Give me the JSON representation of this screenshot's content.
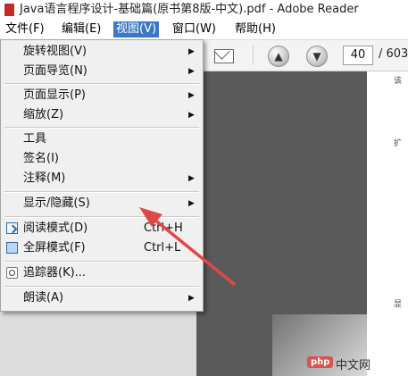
{
  "window": {
    "title": "Java语言程序设计-基础篇(原书第8版-中文).pdf - Adobe Reader"
  },
  "menubar": {
    "items": [
      {
        "label": "文件(F)"
      },
      {
        "label": "编辑(E)"
      },
      {
        "label": "视图(V)",
        "active": true
      },
      {
        "label": "窗口(W)"
      },
      {
        "label": "帮助(H)"
      }
    ]
  },
  "toolbar": {
    "page_number": "40",
    "page_count": "/ 603"
  },
  "view_menu": {
    "items": [
      {
        "label": "旋转视图(V)",
        "submenu": true
      },
      {
        "label": "页面导览(N)",
        "submenu": true
      },
      {
        "label": "页面显示(P)",
        "submenu": true
      },
      {
        "label": "缩放(Z)",
        "submenu": true
      },
      {
        "label": "工具"
      },
      {
        "label": "签名(I)"
      },
      {
        "label": "注释(M)",
        "submenu": true
      },
      {
        "label": "显示/隐藏(S)",
        "submenu": true
      },
      {
        "label": "阅读模式(D)",
        "shortcut": "Ctrl+H",
        "icon": "reading-mode-icon"
      },
      {
        "label": "全屏模式(F)",
        "shortcut": "Ctrl+L",
        "icon": "full-screen-icon"
      },
      {
        "label": "追踪器(K)...",
        "icon": "tracker-icon"
      },
      {
        "label": "朗读(A)",
        "submenu": true
      }
    ]
  },
  "document_snippets": {
    "line1": "该",
    "line2": "扩",
    "line3": "显"
  },
  "watermark": {
    "logo_text": "php",
    "site_text": "中文网"
  },
  "colors": {
    "menu_highlight": "#3a78c6",
    "annotation_arrow": "#e04848"
  }
}
